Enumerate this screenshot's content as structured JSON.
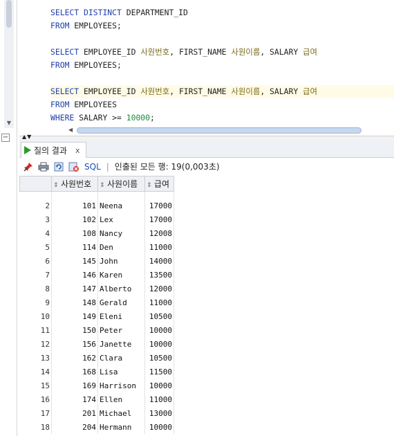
{
  "editor": {
    "lines": [
      {
        "parts": [
          {
            "t": "SELECT ",
            "c": "kw"
          },
          {
            "t": "DISTINCT ",
            "c": "kw"
          },
          {
            "t": "DEPARTMENT_ID",
            "c": ""
          }
        ]
      },
      {
        "parts": [
          {
            "t": "FROM ",
            "c": "kw"
          },
          {
            "t": "EMPLOYEES;",
            "c": ""
          }
        ]
      },
      {
        "parts": []
      },
      {
        "parts": [
          {
            "t": "SELECT ",
            "c": "kw"
          },
          {
            "t": "EMPLOYEE_ID ",
            "c": ""
          },
          {
            "t": "사원번호",
            "c": "ko"
          },
          {
            "t": ", FIRST_NAME ",
            "c": ""
          },
          {
            "t": "사원이름",
            "c": "ko"
          },
          {
            "t": ", SALARY ",
            "c": ""
          },
          {
            "t": "급여",
            "c": "ko"
          }
        ]
      },
      {
        "parts": [
          {
            "t": "FROM ",
            "c": "kw"
          },
          {
            "t": "EMPLOYEES;",
            "c": ""
          }
        ]
      },
      {
        "parts": []
      },
      {
        "parts": [
          {
            "t": "SELECT ",
            "c": "kw"
          },
          {
            "t": "EMPLOYEE_ID ",
            "c": ""
          },
          {
            "t": "사원번호",
            "c": "ko"
          },
          {
            "t": ", FIRST_NAME ",
            "c": ""
          },
          {
            "t": "사원이름",
            "c": "ko"
          },
          {
            "t": ", SALARY ",
            "c": ""
          },
          {
            "t": "급여",
            "c": "ko"
          }
        ],
        "current": true
      },
      {
        "parts": [
          {
            "t": "FROM ",
            "c": "kw"
          },
          {
            "t": "EMPLOYEES",
            "c": ""
          }
        ]
      },
      {
        "parts": [
          {
            "t": "WHERE ",
            "c": "kw"
          },
          {
            "t": "SALARY >= ",
            "c": ""
          },
          {
            "t": "10000",
            "c": "num"
          },
          {
            "t": ";",
            "c": ""
          }
        ]
      }
    ]
  },
  "results": {
    "tab_label": "질의 결과",
    "tab_close": "x",
    "toolbar": {
      "sql_label": "SQL",
      "separator": "|",
      "status": "인출된 모든 행: 19(0,003초)"
    },
    "columns": [
      "사원번호",
      "사원이름",
      "급여"
    ],
    "rows": [
      [
        "2",
        "101",
        "Neena",
        "17000"
      ],
      [
        "3",
        "102",
        "Lex",
        "17000"
      ],
      [
        "4",
        "108",
        "Nancy",
        "12008"
      ],
      [
        "5",
        "114",
        "Den",
        "11000"
      ],
      [
        "6",
        "145",
        "John",
        "14000"
      ],
      [
        "7",
        "146",
        "Karen",
        "13500"
      ],
      [
        "8",
        "147",
        "Alberto",
        "12000"
      ],
      [
        "9",
        "148",
        "Gerald",
        "11000"
      ],
      [
        "10",
        "149",
        "Eleni",
        "10500"
      ],
      [
        "11",
        "150",
        "Peter",
        "10000"
      ],
      [
        "12",
        "156",
        "Janette",
        "10000"
      ],
      [
        "13",
        "162",
        "Clara",
        "10500"
      ],
      [
        "14",
        "168",
        "Lisa",
        "11500"
      ],
      [
        "15",
        "169",
        "Harrison",
        "10000"
      ],
      [
        "16",
        "174",
        "Ellen",
        "11000"
      ],
      [
        "17",
        "201",
        "Michael",
        "13000"
      ],
      [
        "18",
        "204",
        "Hermann",
        "10000"
      ]
    ]
  },
  "colors": {
    "keyword": "#1e3fa8",
    "korean_alias": "#7a6a18",
    "number": "#1a8a3a",
    "current_line": "#fffbe6"
  }
}
